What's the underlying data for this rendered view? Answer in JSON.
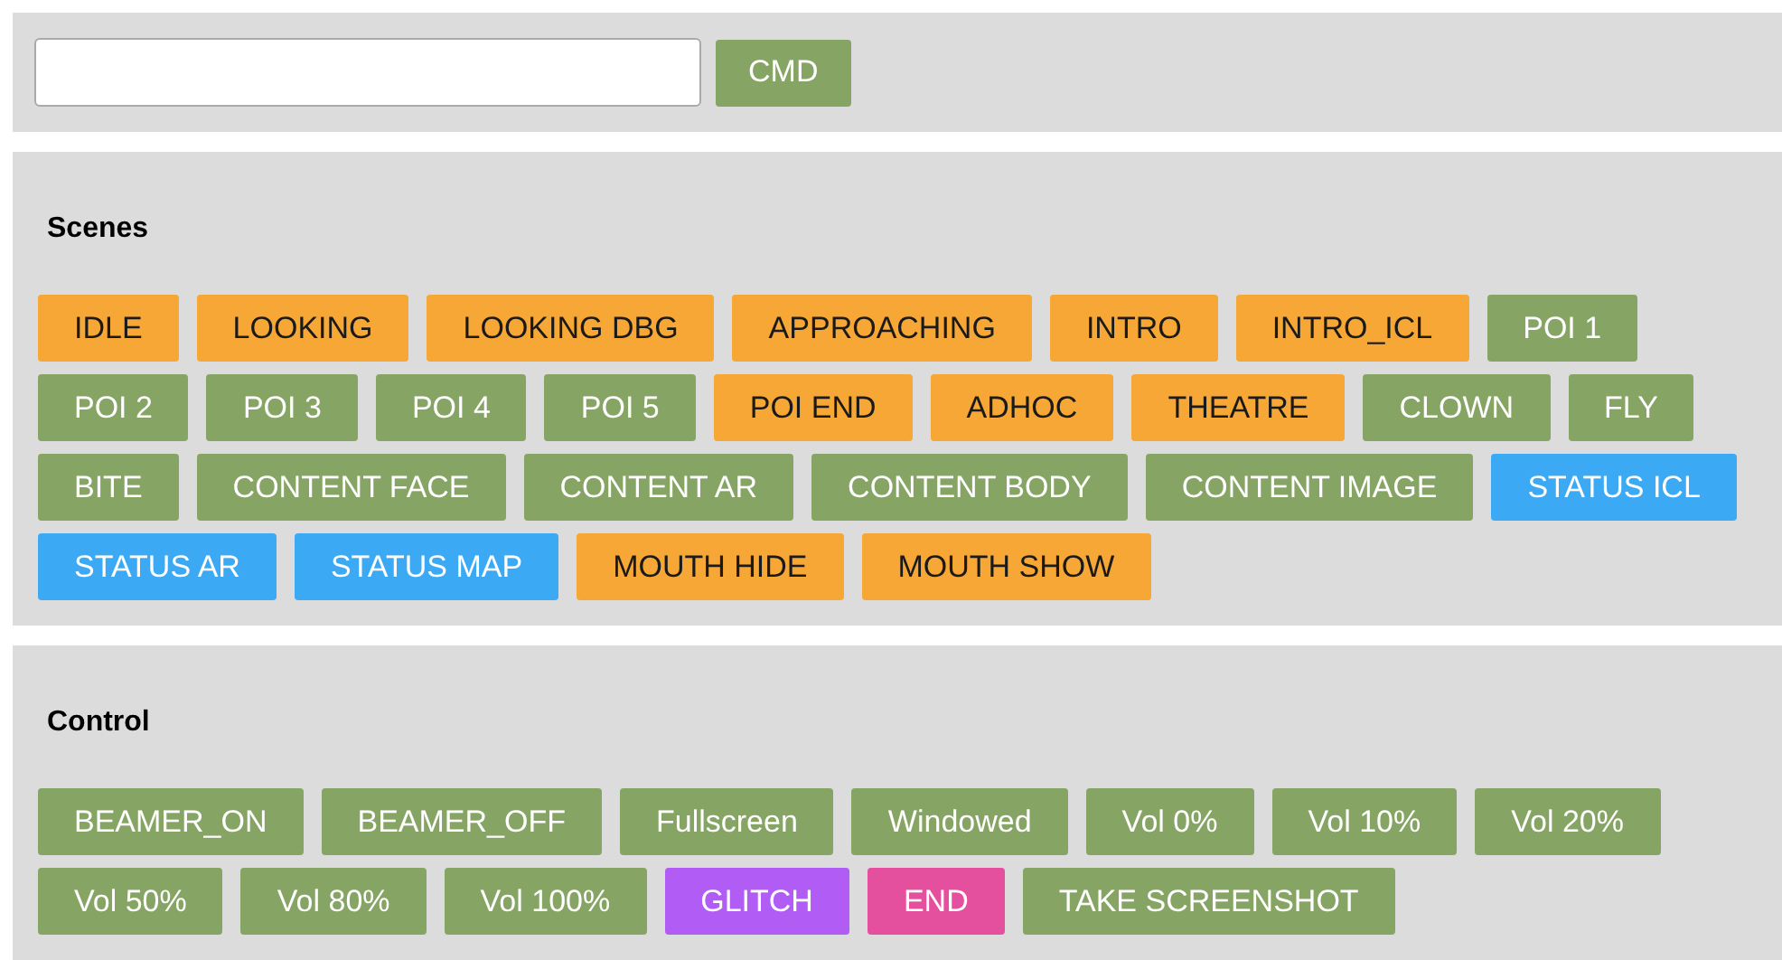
{
  "command": {
    "button": "CMD"
  },
  "sections": [
    {
      "title": "Scenes",
      "buttons": [
        {
          "label": "IDLE",
          "color": "#f6a735"
        },
        {
          "label": "LOOKING",
          "color": "#f6a735"
        },
        {
          "label": "LOOKING DBG",
          "color": "#f6a735"
        },
        {
          "label": "APPROACHING",
          "color": "#f6a735"
        },
        {
          "label": "INTRO",
          "color": "#f6a735"
        },
        {
          "label": "INTRO_ICL",
          "color": "#f6a735"
        },
        {
          "label": "POI 1",
          "color": "#86a463"
        },
        {
          "label": "POI 2",
          "color": "#86a463"
        },
        {
          "label": "POI 3",
          "color": "#86a463"
        },
        {
          "label": "POI 4",
          "color": "#86a463"
        },
        {
          "label": "POI 5",
          "color": "#86a463"
        },
        {
          "label": "POI END",
          "color": "#f6a735"
        },
        {
          "label": "ADHOC",
          "color": "#f6a735"
        },
        {
          "label": "THEATRE",
          "color": "#f6a735"
        },
        {
          "label": "CLOWN",
          "color": "#86a463"
        },
        {
          "label": "FLY",
          "color": "#86a463"
        },
        {
          "label": "BITE",
          "color": "#86a463"
        },
        {
          "label": "CONTENT FACE",
          "color": "#86a463"
        },
        {
          "label": "CONTENT AR",
          "color": "#86a463"
        },
        {
          "label": "CONTENT BODY",
          "color": "#86a463"
        },
        {
          "label": "CONTENT IMAGE",
          "color": "#86a463"
        },
        {
          "label": "STATUS ICL",
          "color": "#3ba9f4"
        },
        {
          "label": "STATUS AR",
          "color": "#3ba9f4"
        },
        {
          "label": "STATUS MAP",
          "color": "#3ba9f4"
        },
        {
          "label": "MOUTH HIDE",
          "color": "#f6a735"
        },
        {
          "label": "MOUTH SHOW",
          "color": "#f6a735"
        }
      ]
    },
    {
      "title": "Control",
      "buttons": [
        {
          "label": "BEAMER_ON",
          "color": "#86a463"
        },
        {
          "label": "BEAMER_OFF",
          "color": "#86a463"
        },
        {
          "label": "Fullscreen",
          "color": "#86a463"
        },
        {
          "label": "Windowed",
          "color": "#86a463"
        },
        {
          "label": "Vol 0%",
          "color": "#86a463"
        },
        {
          "label": "Vol 10%",
          "color": "#86a463"
        },
        {
          "label": "Vol 20%",
          "color": "#86a463"
        },
        {
          "label": "Vol 50%",
          "color": "#86a463"
        },
        {
          "label": "Vol 80%",
          "color": "#86a463"
        },
        {
          "label": "Vol 100%",
          "color": "#86a463"
        },
        {
          "label": "GLITCH",
          "color": "#b15cf5"
        },
        {
          "label": "END",
          "color": "#e5509e"
        },
        {
          "label": "TAKE SCREENSHOT",
          "color": "#86a463"
        }
      ]
    }
  ]
}
